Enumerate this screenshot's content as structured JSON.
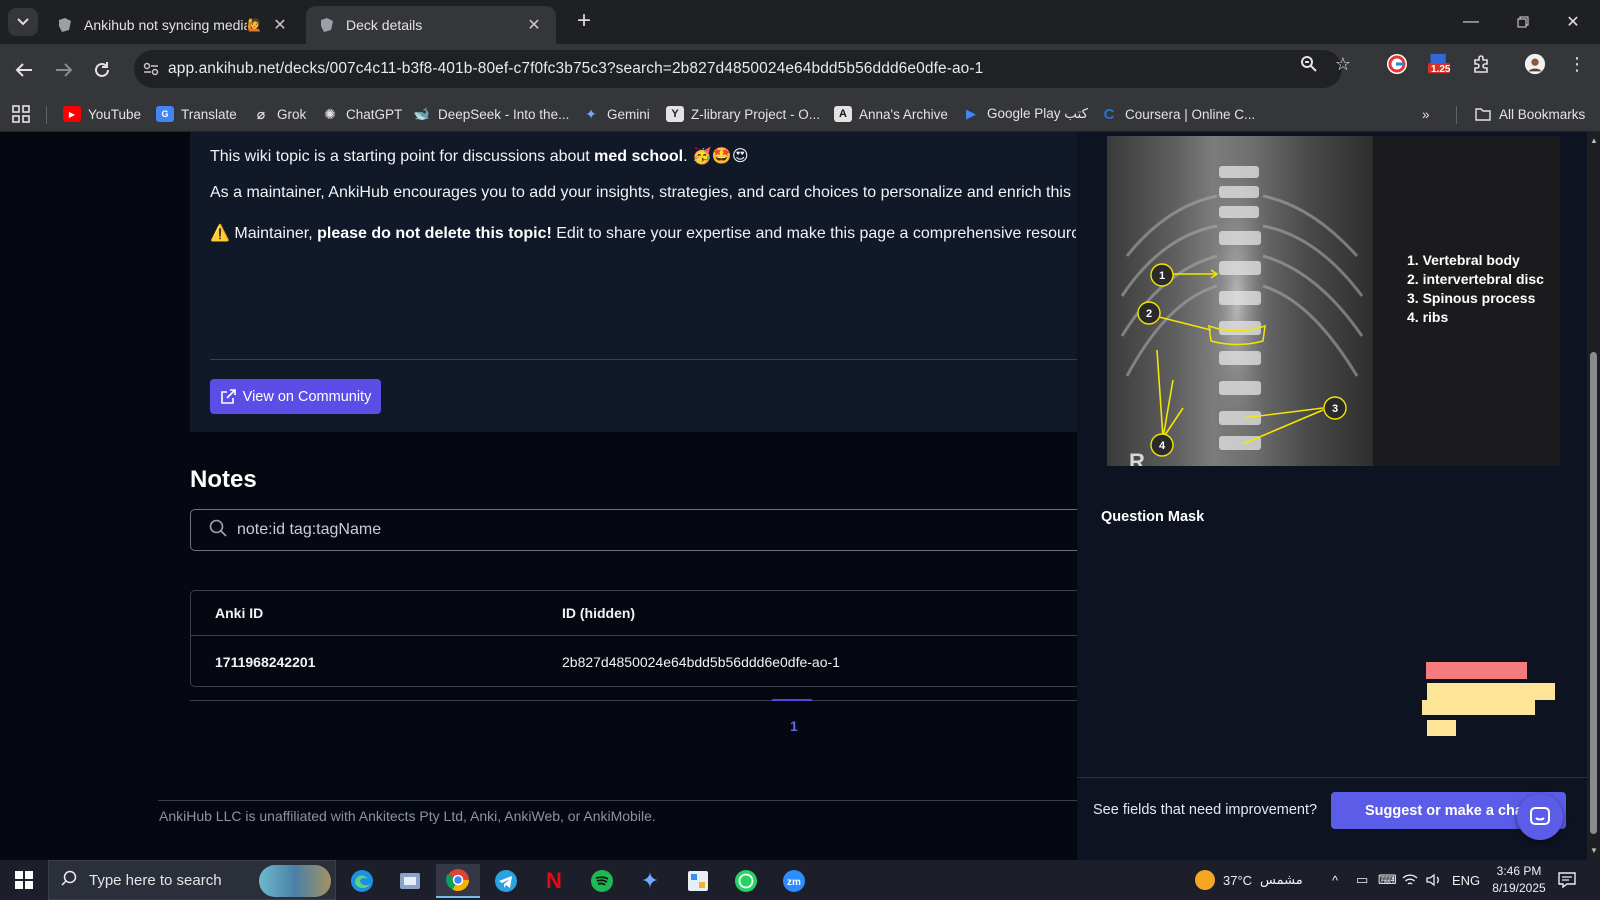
{
  "browser": {
    "tabs": [
      {
        "title": "Ankihub not syncing media - ",
        "active": false
      },
      {
        "title": "Deck details",
        "active": true
      }
    ],
    "url": "app.ankihub.net/decks/007c4c11-b3f8-401b-80ef-c7f0fc3b75c3?search=2b827d4850024e64bdd5b56ddd6e0dfe-ao-1",
    "extension_badge": "1.25",
    "bookmarks": [
      {
        "label": "YouTube",
        "icon": "youtube-icon"
      },
      {
        "label": "Translate",
        "icon": "translate-icon"
      },
      {
        "label": "Grok",
        "icon": "grok-icon"
      },
      {
        "label": "ChatGPT",
        "icon": "chatgpt-icon"
      },
      {
        "label": "DeepSeek - Into the...",
        "icon": "deepseek-icon"
      },
      {
        "label": "Gemini",
        "icon": "gemini-icon"
      },
      {
        "label": "Z-library Project - O...",
        "icon": "zlibrary-icon"
      },
      {
        "label": "Anna's Archive",
        "icon": "annas-archive-icon"
      },
      {
        "label": "Google Play كتب",
        "icon": "google-play-icon"
      },
      {
        "label": "Coursera | Online C...",
        "icon": "coursera-icon"
      }
    ],
    "all_bookmarks": "All Bookmarks"
  },
  "wiki": {
    "line1_pre": "This wiki topic is a starting point for discussions about ",
    "line1_bold": "med school",
    "line1_post": ". 🥳🤩😍",
    "line2": "As a maintainer, AnkiHub encourages you to add your insights, strategies, and card choices to personalize and enrich this co",
    "line3_pre": "Maintainer, ",
    "line3_bold": "please do not delete this topic!",
    "line3_post": " Edit to share your expertise and make this page a comprehensive resource f",
    "community_button": "View on Community"
  },
  "notes": {
    "title": "Notes",
    "search_placeholder": "note:id tag:tagName",
    "columns": [
      "Anki ID",
      "ID (hidden)"
    ],
    "rows": [
      {
        "anki_id": "1711968242201",
        "id_hidden": "2b827d4850024e64bdd5b56ddd6e0dfe-ao-1"
      }
    ],
    "page": "1"
  },
  "footer": "AnkiHub LLC is unaffiliated with Ankitects Pty Ltd, Anki, AnkiWeb, or AnkiMobile.",
  "side_panel": {
    "image_legend": [
      "1. Vertebral body",
      "2. intervertebral disc",
      "3. Spinous process",
      "4. ribs"
    ],
    "image_markers": [
      "1",
      "2",
      "3",
      "4"
    ],
    "image_letter": "R",
    "question_mask_title": "Question Mask",
    "improve_text": "See fields that need improvement?",
    "suggest_button": "Suggest or make a change",
    "mask_colors": {
      "highlight": "#f47c7c",
      "other": "#fde598"
    }
  },
  "taskbar": {
    "search_placeholder": "Type here to search",
    "weather_temp": "37°C",
    "weather_text": "مشمس",
    "language": "ENG",
    "time": "3:46 PM",
    "date": "8/19/2025"
  }
}
